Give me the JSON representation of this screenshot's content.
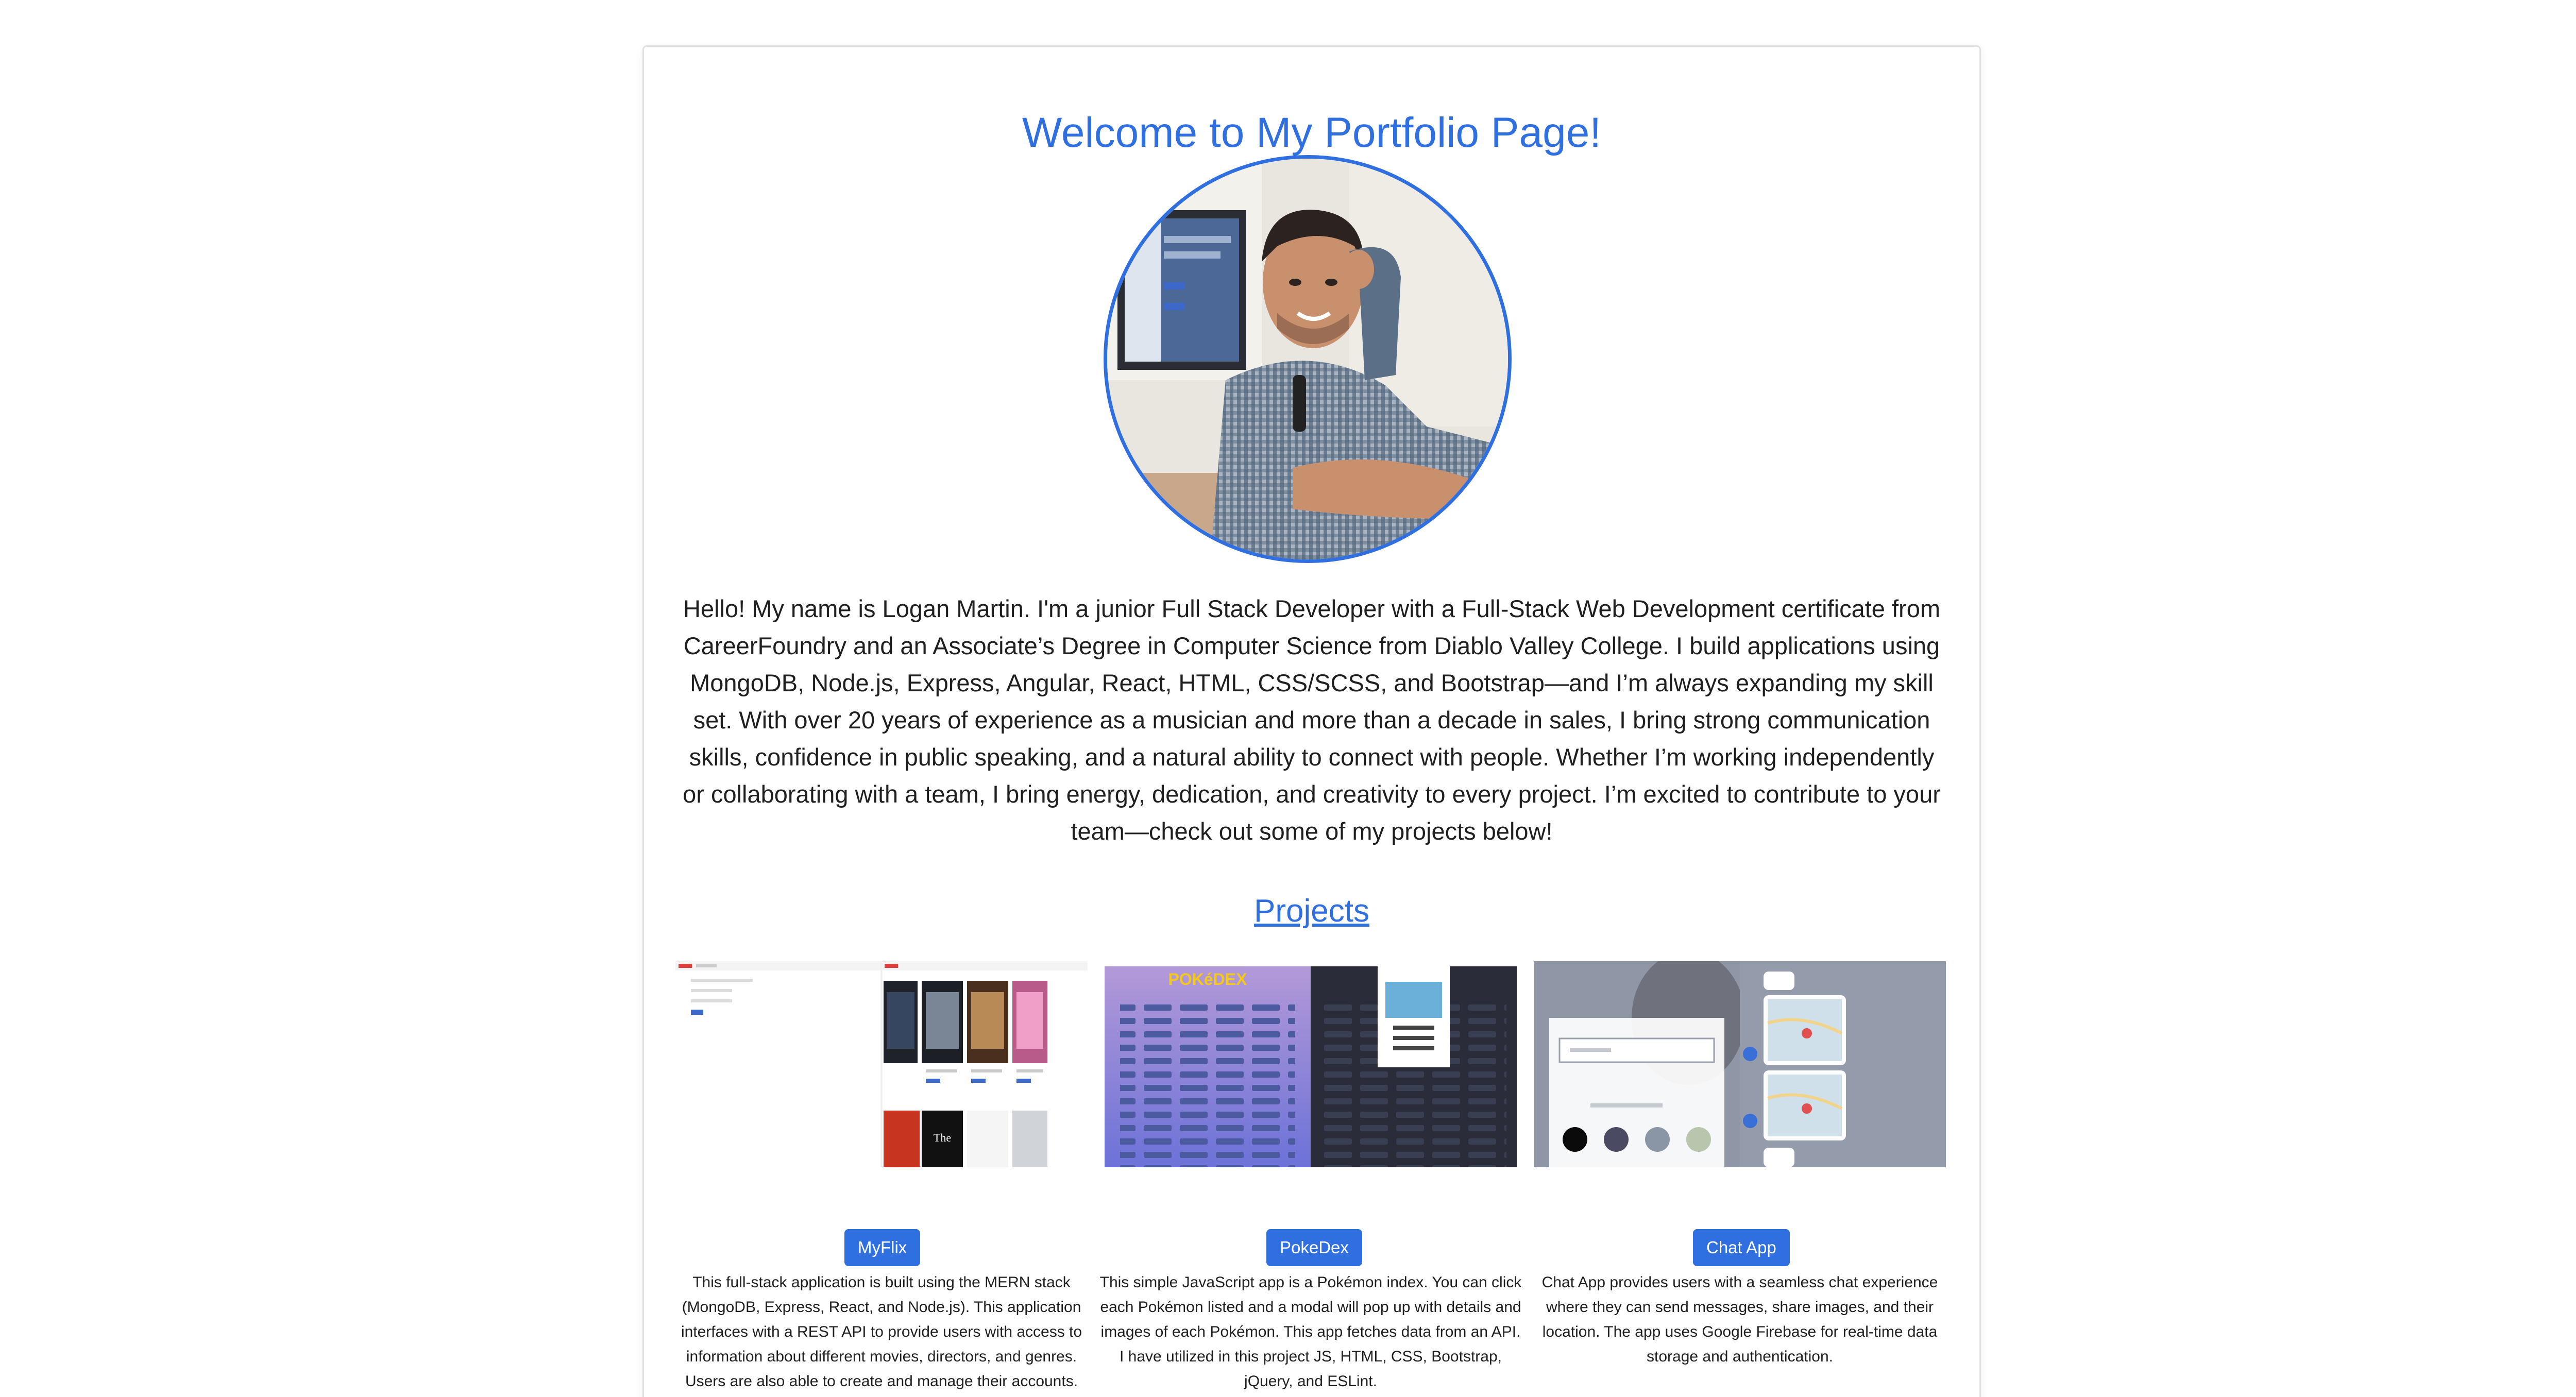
{
  "header": {
    "title": "Welcome to My Portfolio Page!"
  },
  "profile": {
    "bio": "Hello! My name is Logan Martin. I'm a junior Full Stack Developer with a Full-Stack Web Development certificate from CareerFoundry and an Associate’s Degree in Computer Science from Diablo Valley College. I build applications using MongoDB, Node.js, Express, Angular, React, HTML, CSS/SCSS, and Bootstrap—and I’m always expanding my skill set. With over 20 years of experience as a musician and more than a decade in sales, I bring strong communication skills, confidence in public speaking, and a natural ability to connect with people. Whether I’m working independently or collaborating with a team, I bring energy, dedication, and creativity to every project. I’m excited to contribute to your team—check out some of my projects below!"
  },
  "projects": {
    "heading": "Projects",
    "items": [
      {
        "label": "MyFlix",
        "description": "This full-stack application is built using the MERN stack (MongoDB, Express, React, and Node.js). This application interfaces with a REST API to provide users with access to information about different movies, directors, and genres. Users are also able to create and manage their accounts."
      },
      {
        "label": "PokeDex",
        "description": "This simple JavaScript app is a Pokémon index. You can click each Pokémon listed and a modal will pop up with details and images of each Pokémon. This app fetches data from an API. I have utilized in this project JS, HTML, CSS, Bootstrap, jQuery, and ESLint."
      },
      {
        "label": "Chat App",
        "description": "Chat App provides users with a seamless chat experience where they can send messages, share images, and their location. The app uses Google Firebase for real-time data storage and authentication."
      }
    ]
  },
  "colors": {
    "accent": "#2f6fe0",
    "text": "#1f1f1f"
  }
}
